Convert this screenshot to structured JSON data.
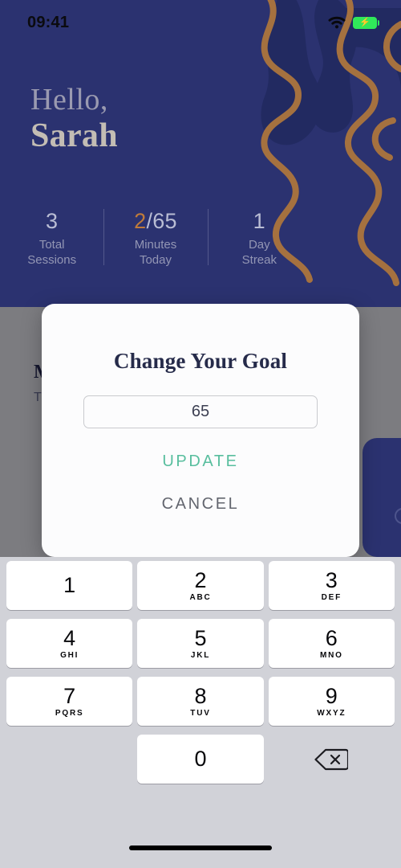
{
  "status_bar": {
    "time": "09:41",
    "wifi_icon": "wifi-icon",
    "battery_icon": "battery-charging-icon",
    "battery_color": "#30E85A"
  },
  "greeting": {
    "hello": "Hello,",
    "name": "Sarah"
  },
  "stats": [
    {
      "value": "3",
      "accent_value": "",
      "suffix": "",
      "label_line1": "Total",
      "label_line2": "Sessions"
    },
    {
      "value": "",
      "accent_value": "2",
      "suffix": "/65",
      "label_line1": "Minutes",
      "label_line2": "Today"
    },
    {
      "value": "1",
      "accent_value": "",
      "suffix": "",
      "label_line1": "Day",
      "label_line2": "Streak"
    }
  ],
  "behind_content": {
    "card_title": "M",
    "card_subtitle": "T"
  },
  "dialog": {
    "title": "Change Your Goal",
    "input_value": "65",
    "input_placeholder": "65",
    "update_label": "UPDATE",
    "cancel_label": "CANCEL",
    "update_color": "#58BE9E",
    "cancel_color": "#63666F"
  },
  "keyboard": {
    "keys": [
      {
        "num": "1",
        "sub": ""
      },
      {
        "num": "2",
        "sub": "ABC"
      },
      {
        "num": "3",
        "sub": "DEF"
      },
      {
        "num": "4",
        "sub": "GHI"
      },
      {
        "num": "5",
        "sub": "JKL"
      },
      {
        "num": "6",
        "sub": "MNO"
      },
      {
        "num": "7",
        "sub": "PQRS"
      },
      {
        "num": "8",
        "sub": "TUV"
      },
      {
        "num": "9",
        "sub": "WXYZ"
      },
      {
        "num": "0",
        "sub": ""
      }
    ],
    "delete_icon": "backspace-delete-icon"
  },
  "theme": {
    "navy": "#2B3270",
    "scrim_gray": "#7C7C80",
    "keyboard_bg": "#D1D2D8",
    "accent_orange": "#C07B3A",
    "accent_teal": "#58BE9E",
    "dialog_bg": "#FCFCFD"
  }
}
